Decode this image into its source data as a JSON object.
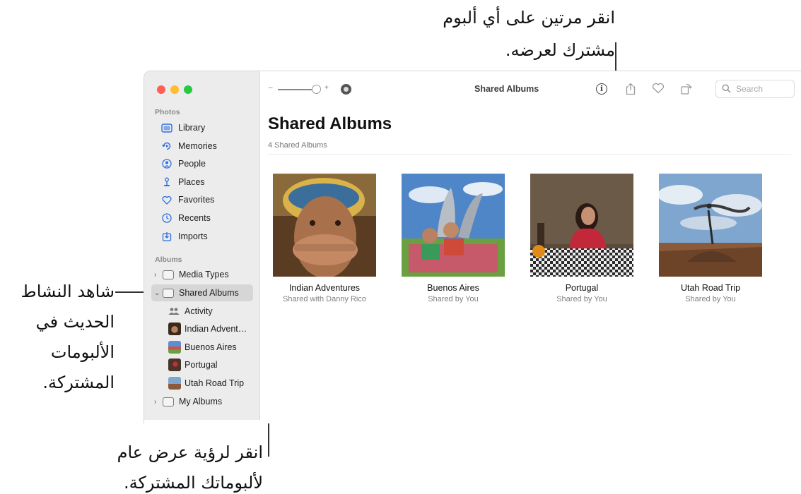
{
  "callouts": {
    "top": [
      "انقر مرتين على أي ألبوم",
      "مشترك لعرضه."
    ],
    "left": [
      "شاهد النشاط",
      "الحديث في",
      "الألبومات",
      "المشتركة."
    ],
    "bottom": [
      "انقر لرؤية عرض عام",
      "لألبوماتك المشتركة."
    ]
  },
  "toolbar": {
    "zoom_minus": "–",
    "zoom_plus": "+",
    "window_title": "Shared Albums",
    "search_placeholder": "Search",
    "info_icon_glyph": "i"
  },
  "sidebar": {
    "photos_header": "Photos",
    "albums_header": "Albums",
    "items": [
      {
        "label": "Library",
        "icon": "library-icon"
      },
      {
        "label": "Memories",
        "icon": "memories-icon"
      },
      {
        "label": "People",
        "icon": "people-icon"
      },
      {
        "label": "Places",
        "icon": "places-icon"
      },
      {
        "label": "Favorites",
        "icon": "favorites-icon"
      },
      {
        "label": "Recents",
        "icon": "recents-icon"
      },
      {
        "label": "Imports",
        "icon": "imports-icon"
      }
    ],
    "groups": {
      "media_types": "Media Types",
      "shared_albums": "Shared Albums",
      "my_albums": "My Albums"
    },
    "shared_children": [
      "Activity",
      "Indian Advent…",
      "Buenos Aires",
      "Portugal",
      "Utah Road Trip"
    ]
  },
  "main": {
    "title": "Shared Albums",
    "count": "4 Shared Albums",
    "albums": [
      {
        "title": "Indian Adventures",
        "subtitle": "Shared with Danny Rico"
      },
      {
        "title": "Buenos Aires",
        "subtitle": "Shared by You"
      },
      {
        "title": "Portugal",
        "subtitle": "Shared by You"
      },
      {
        "title": "Utah Road Trip",
        "subtitle": "Shared by You"
      }
    ]
  },
  "colors": {
    "accent": "#2f6fe0",
    "close": "#ff5f57",
    "minimize": "#febc2e",
    "maximize": "#28c840",
    "sidebar_bg": "#ececec",
    "selection": "#d6d6d6"
  }
}
